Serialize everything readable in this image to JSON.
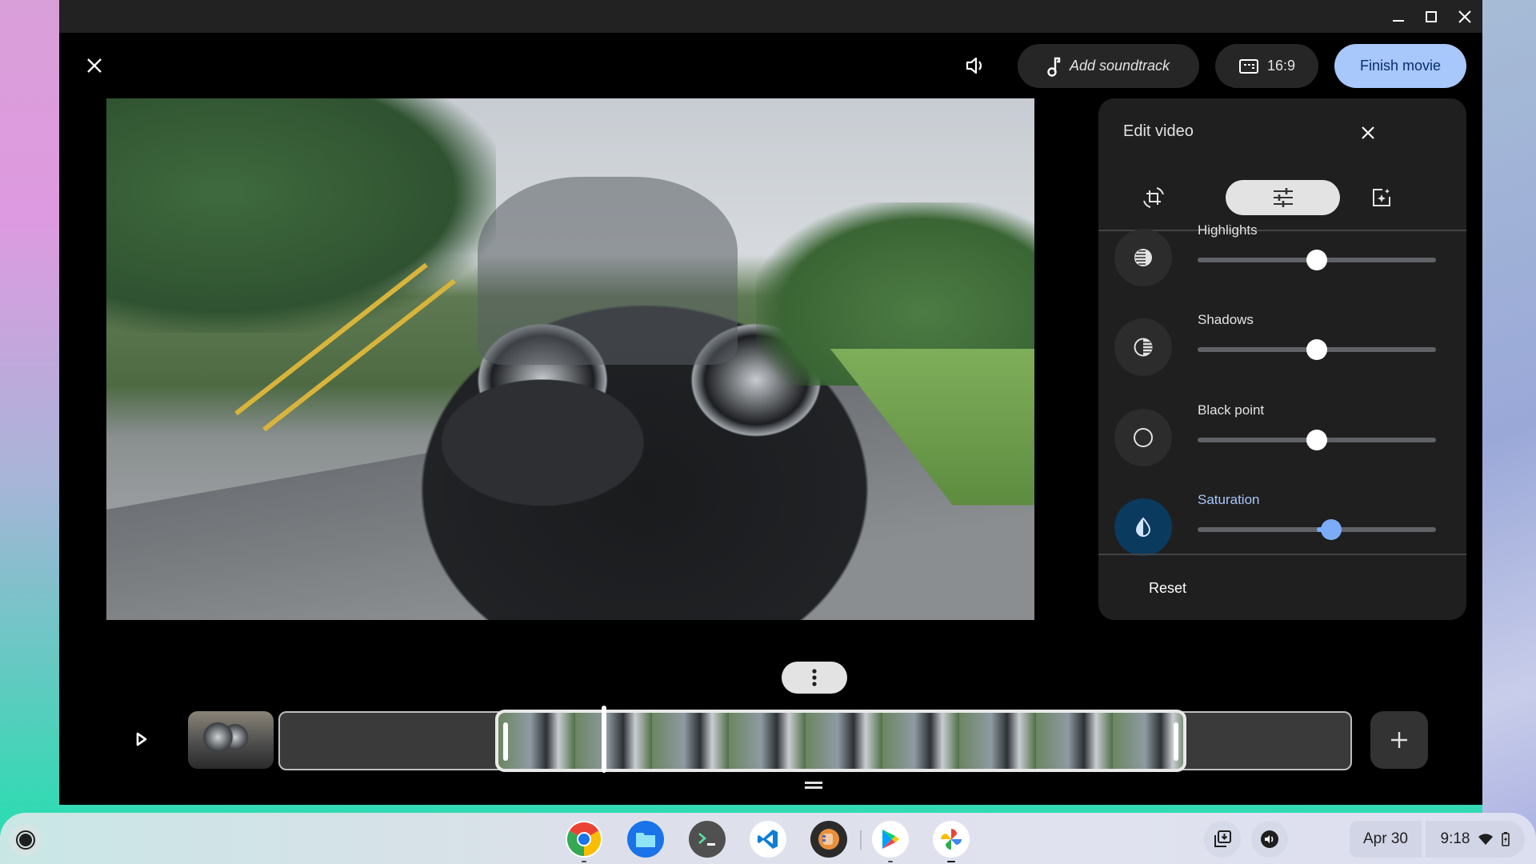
{
  "window": {
    "controls": {
      "minimize": "minimize",
      "maximize": "maximize",
      "close": "close"
    }
  },
  "toolbar": {
    "close_icon": "close-icon",
    "volume_icon": "volume-icon",
    "add_soundtrack_label": "Add soundtrack",
    "aspect_ratio_label": "16:9",
    "finish_label": "Finish movie"
  },
  "edit_panel": {
    "title": "Edit video",
    "tabs": [
      {
        "name": "crop-rotate",
        "active": false
      },
      {
        "name": "adjust",
        "active": true
      },
      {
        "name": "filters",
        "active": false
      }
    ],
    "adjustments": [
      {
        "label": "Highlights",
        "icon": "highlights-icon",
        "value_fraction": 0.5,
        "active": false
      },
      {
        "label": "Shadows",
        "icon": "shadows-icon",
        "value_fraction": 0.5,
        "active": false
      },
      {
        "label": "Black point",
        "icon": "black-point-icon",
        "value_fraction": 0.5,
        "active": false
      },
      {
        "label": "Saturation",
        "icon": "saturation-icon",
        "value_fraction": 0.56,
        "active": true
      }
    ],
    "reset_label": "Reset",
    "accent_color": "#a8c7fa"
  },
  "timeline": {
    "clip_count": 3,
    "selected_clip": 2,
    "more_options_icon": "more-vertical-icon",
    "add_clip_icon": "plus-icon",
    "play_icon": "play-icon"
  },
  "shelf": {
    "apps": [
      {
        "name": "Chrome"
      },
      {
        "name": "Files"
      },
      {
        "name": "Terminal"
      },
      {
        "name": "Visual Studio Code"
      },
      {
        "name": "App"
      },
      {
        "name": "Play Store"
      },
      {
        "name": "Google Photos"
      }
    ],
    "date": "Apr 30",
    "time": "9:18"
  }
}
